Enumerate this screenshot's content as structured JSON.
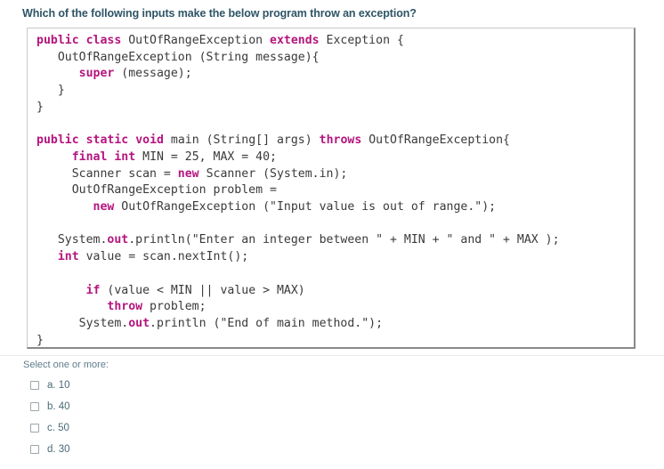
{
  "question": {
    "title": "Which of the following inputs make the below program throw an exception?"
  },
  "code": {
    "language": "java",
    "lines": [
      {
        "tokens": [
          {
            "t": "public",
            "k": true
          },
          {
            "t": " ",
            "k": false
          },
          {
            "t": "class",
            "k": true
          },
          {
            "t": " OutOfRangeException ",
            "k": false
          },
          {
            "t": "extends",
            "k": true
          },
          {
            "t": " Exception {",
            "k": false
          }
        ]
      },
      {
        "tokens": [
          {
            "t": "   OutOfRangeException (String message){",
            "k": false
          }
        ]
      },
      {
        "tokens": [
          {
            "t": "      ",
            "k": false
          },
          {
            "t": "super",
            "k": true
          },
          {
            "t": " (message);",
            "k": false
          }
        ]
      },
      {
        "tokens": [
          {
            "t": "   }",
            "k": false
          }
        ]
      },
      {
        "tokens": [
          {
            "t": "}",
            "k": false
          }
        ]
      },
      {
        "tokens": [
          {
            "t": "",
            "k": false
          }
        ]
      },
      {
        "tokens": [
          {
            "t": "public",
            "k": true
          },
          {
            "t": " ",
            "k": false
          },
          {
            "t": "static",
            "k": true
          },
          {
            "t": " ",
            "k": false
          },
          {
            "t": "void",
            "k": true
          },
          {
            "t": " main (String[] args) ",
            "k": false
          },
          {
            "t": "throws",
            "k": true
          },
          {
            "t": " OutOfRangeException{",
            "k": false
          }
        ]
      },
      {
        "tokens": [
          {
            "t": "     ",
            "k": false
          },
          {
            "t": "final",
            "k": true
          },
          {
            "t": " ",
            "k": false
          },
          {
            "t": "int",
            "k": true
          },
          {
            "t": " MIN = 25, MAX = 40;",
            "k": false
          }
        ]
      },
      {
        "tokens": [
          {
            "t": "     Scanner scan = ",
            "k": false
          },
          {
            "t": "new",
            "k": true
          },
          {
            "t": " Scanner (System.in);",
            "k": false
          }
        ]
      },
      {
        "tokens": [
          {
            "t": "     OutOfRangeException problem =",
            "k": false
          }
        ]
      },
      {
        "tokens": [
          {
            "t": "        ",
            "k": false
          },
          {
            "t": "new",
            "k": true
          },
          {
            "t": " OutOfRangeException (\"Input value is out of range.\");",
            "k": false
          }
        ]
      },
      {
        "tokens": [
          {
            "t": "",
            "k": false
          }
        ]
      },
      {
        "tokens": [
          {
            "t": "   System.",
            "k": false
          },
          {
            "t": "out",
            "k": true
          },
          {
            "t": ".println(\"Enter an integer between \" + MIN + \" and \" + MAX );",
            "k": false
          }
        ]
      },
      {
        "tokens": [
          {
            "t": "   ",
            "k": false
          },
          {
            "t": "int",
            "k": true
          },
          {
            "t": " value = scan.nextInt();",
            "k": false
          }
        ]
      },
      {
        "tokens": [
          {
            "t": "",
            "k": false
          }
        ]
      },
      {
        "tokens": [
          {
            "t": "       ",
            "k": false
          },
          {
            "t": "if",
            "k": true
          },
          {
            "t": " (value < MIN || value > MAX)",
            "k": false
          }
        ]
      },
      {
        "tokens": [
          {
            "t": "          ",
            "k": false
          },
          {
            "t": "throw",
            "k": true
          },
          {
            "t": " problem;",
            "k": false
          }
        ]
      },
      {
        "tokens": [
          {
            "t": "      System.",
            "k": false
          },
          {
            "t": "out",
            "k": true
          },
          {
            "t": ".println (\"End of main method.\");",
            "k": false
          }
        ]
      },
      {
        "tokens": [
          {
            "t": "}",
            "k": false
          }
        ]
      }
    ]
  },
  "answers": {
    "hint": "Select one or more:",
    "options": [
      {
        "label": "a. 10",
        "checked": false
      },
      {
        "label": "b. 40",
        "checked": false
      },
      {
        "label": "c. 50",
        "checked": false
      },
      {
        "label": "d. 30",
        "checked": false
      }
    ]
  },
  "colors": {
    "title": "#2e5566",
    "keyword": "#b5157e",
    "code_text": "#3a3a3a",
    "option_text": "#4a6b78",
    "hint_text": "#5f7d8c",
    "box_border": "#8a8a8a"
  }
}
